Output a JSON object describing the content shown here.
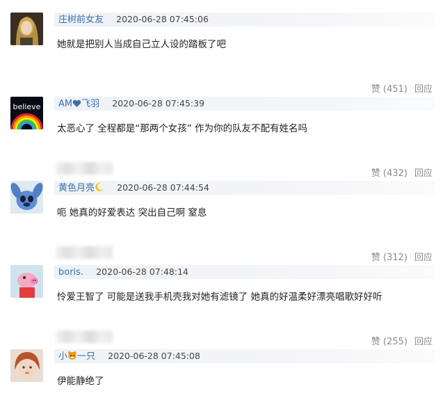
{
  "comments": [
    {
      "user": "庄树前女友",
      "time": "2020-06-28 07:45:06",
      "text": "她就是把别人当成自己立人设的踏板了吧",
      "likes": "赞 (451)",
      "reply": "回应"
    },
    {
      "user_prefix": "AM",
      "user_suffix": "飞羽",
      "time": "2020-06-28 07:45:39",
      "text": "太恶心了 全程都是“那两个女孩” 作为你的队友不配有姓名吗",
      "likes": "赞 (432)",
      "reply": "回应"
    },
    {
      "user": "黄色月亮",
      "time": "2020-06-28 07:44:54",
      "text": "呃 她真的好爱表达 突出自己啊 窒息",
      "likes": "赞 (312)",
      "reply": "回应"
    },
    {
      "user": "boris.",
      "time": "2020-06-28 07:48:14",
      "text": "怜爱王智了 可能是送我手机壳我对她有滤镜了 她真的好温柔好漂亮唱歌好好听",
      "likes": "赞 (255)",
      "reply": "回应"
    },
    {
      "user_prefix": "小",
      "user_suffix": "一只",
      "time": "2020-06-28 07:45:08",
      "text": "伊能静绝了"
    }
  ],
  "avatar2_text": "believe",
  "colors": {
    "username": "#3b6fb0",
    "meta_bar": "#eef2f6",
    "action": "#8a8a8a"
  }
}
